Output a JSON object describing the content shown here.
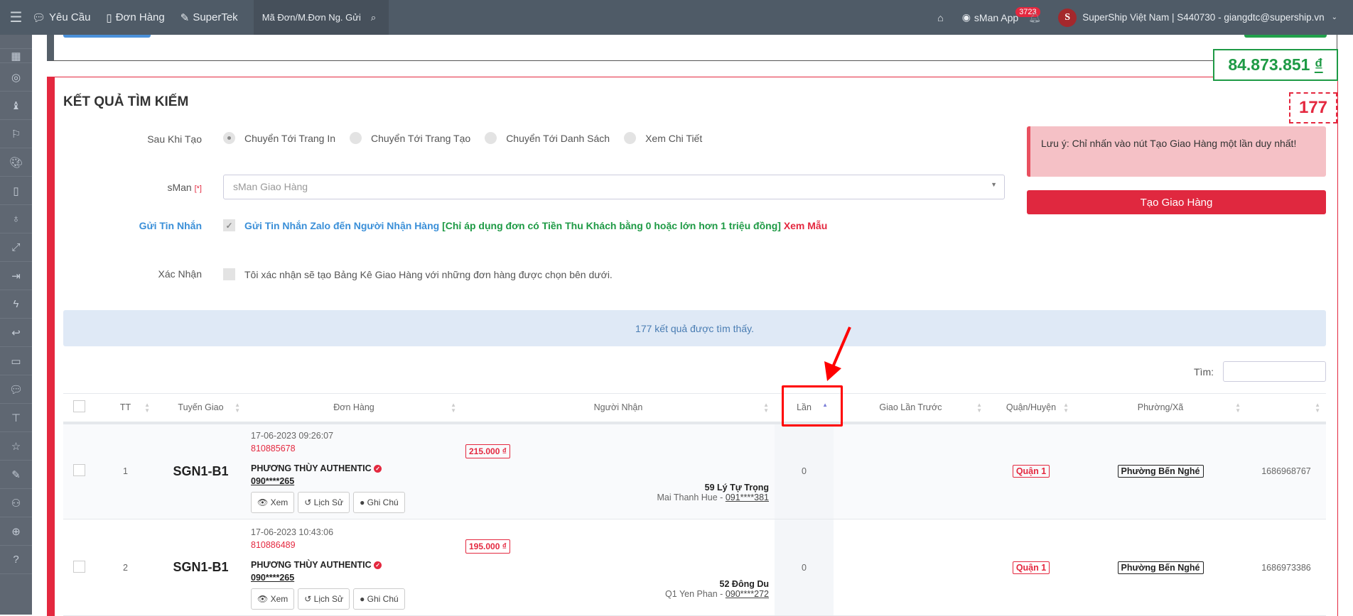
{
  "topbar": {
    "nav": [
      {
        "icon": "chat-icon",
        "label": "Yêu Cầu"
      },
      {
        "icon": "notebook-icon",
        "label": "Đơn Hàng"
      },
      {
        "icon": "edit-icon",
        "label": "SuperTek"
      }
    ],
    "search_placeholder": "Mã Đơn/M.Đơn Ng. Gửi",
    "app_label": "sMan App",
    "notification_count": "3723",
    "account": "SuperShip Việt Nam | S440730 - giangdtc@supership.vn",
    "avatar_letter": "S"
  },
  "sidebar": {
    "icons": [
      "grid-icon",
      "compass-icon",
      "chess-icon",
      "flag-icon",
      "palette-icon",
      "notebook-icon",
      "lightbulb-icon",
      "expand-icon",
      "login-icon",
      "bolt-icon",
      "reply-icon",
      "folder-icon",
      "chat-icon",
      "signpost-icon",
      "star-icon",
      "edit-icon",
      "user-icon",
      "globe-icon",
      "help-icon"
    ]
  },
  "summary": {
    "amount": "84.873.851",
    "currency": "₫",
    "count": "177"
  },
  "results": {
    "title": "KẾT QUẢ TÌM KIẾM",
    "after_create": {
      "label": "Sau Khi Tạo",
      "options": [
        "Chuyển Tới Trang In",
        "Chuyển Tới Trang Tạo",
        "Chuyển Tới Danh Sách",
        "Xem Chi Tiết"
      ],
      "selected": "Chuyển Tới Trang In"
    },
    "sman": {
      "label": "sMan",
      "required": "[*]",
      "placeholder": "sMan Giao Hàng"
    },
    "send_message": {
      "label": "Gửi Tin Nhắn",
      "checked": true,
      "text_blue": "Gửi Tin Nhắn Zalo đến Người Nhận Hàng",
      "text_green": "[Chỉ áp dụng đơn có Tiền Thu Khách bằng 0 hoặc lớn hơn 1 triệu đồng]",
      "link": "Xem Mẫu"
    },
    "confirm": {
      "label": "Xác Nhận",
      "checked": false,
      "text": "Tôi xác nhận sẽ tạo Bảng Kê Giao Hàng với những đơn hàng được chọn bên dưới."
    },
    "alert": "Lưu ý: Chỉ nhấn vào nút Tạo Giao Hàng một lần duy nhất!",
    "create_button": "Tạo Giao Hàng",
    "info": "177 kết quả được tìm thấy.",
    "search_label": "Tìm:"
  },
  "table": {
    "columns": [
      "TT",
      "Tuyến Giao",
      "Đơn Hàng",
      "Người Nhận",
      "Lần",
      "Giao Lần Trước",
      "Quận/Huyện",
      "Phường/Xã",
      ""
    ],
    "sorted_column": "Lần",
    "sort_direction": "asc",
    "action_labels": {
      "view": "Xem",
      "history": "Lịch Sử",
      "note": "Ghi Chú"
    },
    "rows": [
      {
        "tt": "1",
        "route": "SGN1-B1",
        "datetime": "17-06-2023 09:26:07",
        "order_id": "810885678",
        "shop": "PHƯƠNG THÙY AUTHENTIC",
        "shop_phone": "090****265",
        "price": "215.000 ₫",
        "address": "59 Lý Tự Trọng",
        "receiver": "Mai Thanh Hue - ",
        "receiver_phone": "091****381",
        "times": "0",
        "prev": "",
        "district": "Quận 1",
        "ward": "Phường Bến Nghé",
        "code": "1686968767"
      },
      {
        "tt": "2",
        "route": "SGN1-B1",
        "datetime": "17-06-2023 10:43:06",
        "order_id": "810886489",
        "shop": "PHƯƠNG THÙY AUTHENTIC",
        "shop_phone": "090****265",
        "price": "195.000 ₫",
        "address": "52 Đông Du",
        "receiver": "Q1 Yen Phan - ",
        "receiver_phone": "090****272",
        "times": "0",
        "prev": "",
        "district": "Quận 1",
        "ward": "Phường Bến Nghé",
        "code": "1686973386"
      }
    ]
  },
  "colors": {
    "topbar": "#4f5b67",
    "sidebar": "#5f6772",
    "danger": "#e4283f",
    "success": "#1e9a45",
    "annotation": "#ff0000"
  }
}
